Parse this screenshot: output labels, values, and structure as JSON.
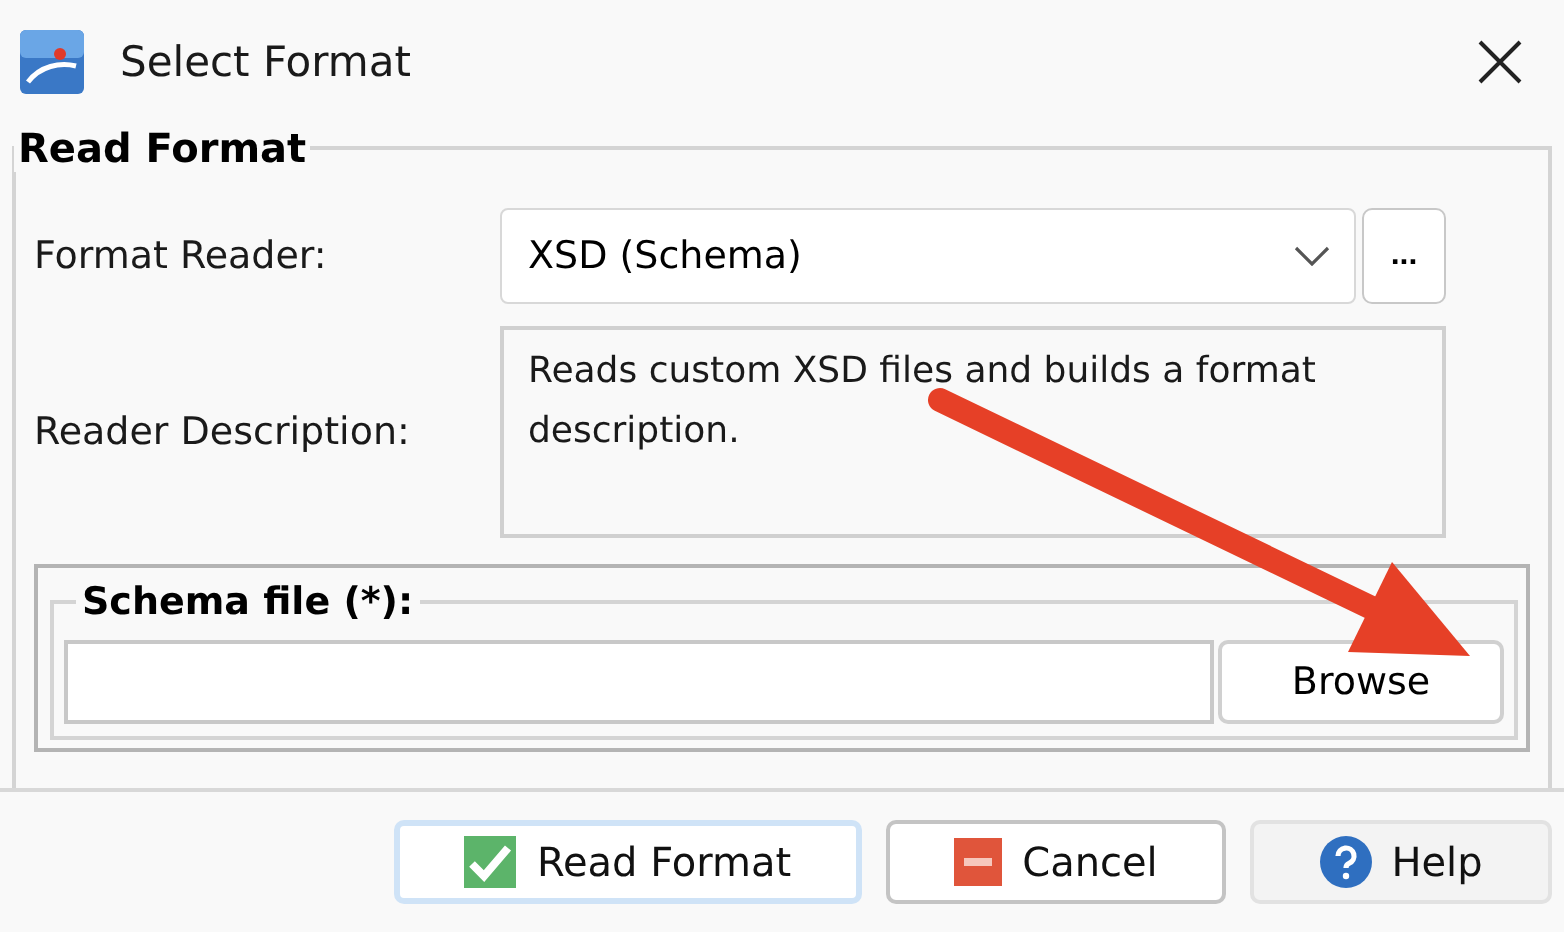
{
  "window": {
    "title": "Select Format"
  },
  "group": {
    "legend": "Read Format"
  },
  "format_reader": {
    "label": "Format Reader:",
    "value": "XSD (Schema)",
    "more_button": "..."
  },
  "reader_description": {
    "label": "Reader Description:",
    "text": "Reads custom XSD files and builds a format description."
  },
  "schema_file": {
    "legend": "Schema file (*):",
    "browse_button": "Browse"
  },
  "buttons": [
    {
      "label": "Read Format",
      "kind": "ok",
      "focused": true
    },
    {
      "label": "Cancel",
      "kind": "cancel",
      "focused": false
    },
    {
      "label": "Help",
      "kind": "help",
      "focused": false
    }
  ]
}
